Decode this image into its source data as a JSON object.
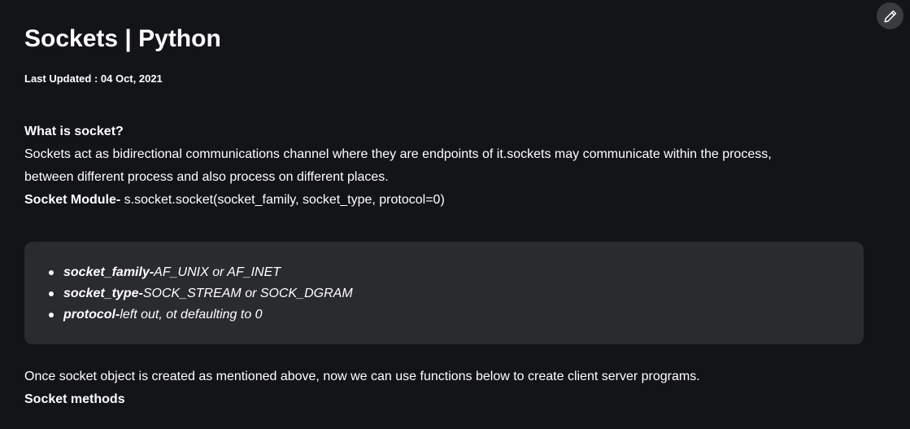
{
  "article": {
    "title": "Sockets | Python",
    "last_updated": "Last Updated : 04 Oct, 2021",
    "heading_what_is": "What is socket?",
    "intro_line_1": "Sockets act as bidirectional communications channel where they are endpoints of it.sockets may communicate within the process,",
    "intro_line_2": "between different process and also process on different places.",
    "module_label": "Socket Module-",
    "module_code": " s.socket.socket(socket_family, socket_type, protocol=0)",
    "params": [
      {
        "term": "socket_family-",
        "desc": "AF_UNIX or AF_INET"
      },
      {
        "term": "socket_type-",
        "desc": "SOCK_STREAM or SOCK_DGRAM"
      },
      {
        "term": "protocol-",
        "desc": "left out, ot defaulting to 0"
      }
    ],
    "after_text": "Once socket object is created as mentioned above, now we can use functions below to create client server programs.",
    "methods_heading": "Socket methods"
  },
  "toolbar": {
    "edit_icon": "pencil-icon"
  }
}
